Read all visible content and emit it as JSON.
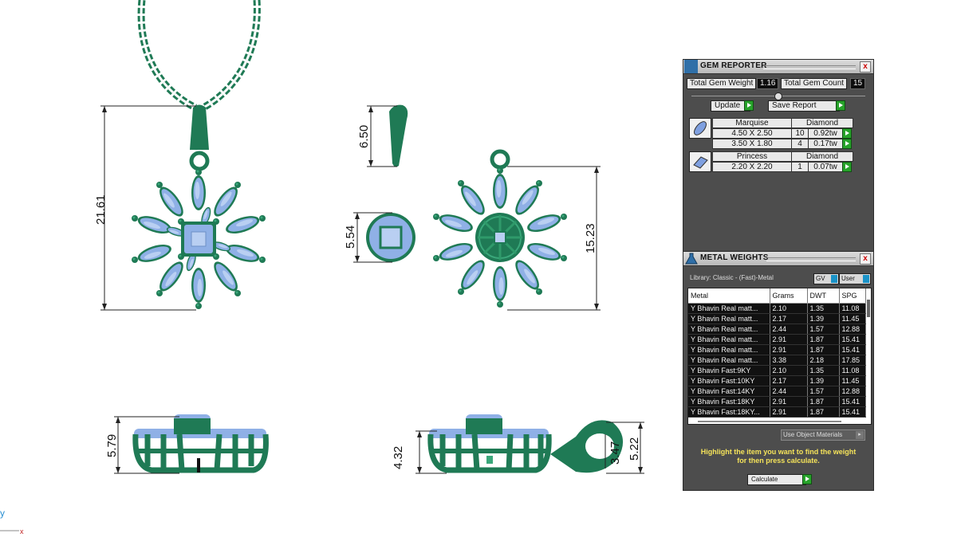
{
  "dimensions": {
    "pendant_height": "21.61",
    "bail_height": "6.50",
    "center_width": "5.54",
    "flower_height": "15.23",
    "side_height_a": "5.79",
    "side_height_b": "4.32",
    "bail_side_a": "3.47",
    "bail_side_b": "5.22"
  },
  "axis": {
    "y_label": "y",
    "x_label": "x"
  },
  "colors": {
    "metal": "#1f7a55",
    "stone": "#8fb0e6",
    "panel_bg": "#4d4d4d",
    "accent_green": "#27a32a",
    "hint_yellow": "#f5e35a"
  },
  "gem_reporter": {
    "title": "GEM REPORTER",
    "close": "x",
    "total_weight_label": "Total Gem Weight",
    "total_weight_value": "1.16",
    "total_count_label": "Total Gem Count",
    "total_count_value": "15",
    "update_label": "Update",
    "save_label": "Save Report",
    "groups": [
      {
        "icon": "marquise-gem-icon",
        "shape": "Marquise",
        "material": "Diamond",
        "rows": [
          {
            "size": "4.50 X 2.50",
            "count": "10",
            "weight": "0.92tw"
          },
          {
            "size": "3.50 X 1.80",
            "count": "4",
            "weight": "0.17tw"
          }
        ]
      },
      {
        "icon": "princess-gem-icon",
        "shape": "Princess",
        "material": "Diamond",
        "rows": [
          {
            "size": "2.20 X 2.20",
            "count": "1",
            "weight": "0.07tw"
          }
        ]
      }
    ]
  },
  "metal_weights": {
    "title": "METAL WEIGHTS",
    "close": "x",
    "library_label": "Library: Classic - (Fast)-Metal",
    "gv_label": "GV",
    "user_label": "User",
    "columns": [
      "Metal",
      "Grams",
      "DWT",
      "SPG"
    ],
    "rows": [
      [
        "Y Bhavin Real matt...",
        "2.10",
        "1.35",
        "11.08"
      ],
      [
        "Y Bhavin Real matt...",
        "2.17",
        "1.39",
        "11.45"
      ],
      [
        "Y Bhavin Real matt...",
        "2.44",
        "1.57",
        "12.88"
      ],
      [
        "Y Bhavin Real matt...",
        "2.91",
        "1.87",
        "15.41"
      ],
      [
        "Y Bhavin Real matt...",
        "2.91",
        "1.87",
        "15.41"
      ],
      [
        "Y Bhavin Real matt...",
        "3.38",
        "2.18",
        "17.85"
      ],
      [
        "Y Bhavin Fast:9KY",
        "2.10",
        "1.35",
        "11.08"
      ],
      [
        "Y Bhavin Fast:10KY",
        "2.17",
        "1.39",
        "11.45"
      ],
      [
        "Y Bhavin Fast:14KY",
        "2.44",
        "1.57",
        "12.88"
      ],
      [
        "Y Bhavin Fast:18KY",
        "2.91",
        "1.87",
        "15.41"
      ],
      [
        "Y Bhavin Fast:18KY...",
        "2.91",
        "1.87",
        "15.41"
      ]
    ],
    "use_object_materials": "Use Object Materials",
    "hint_line1": "Highlight the item you want to find the weight",
    "hint_line2": "for then press calculate.",
    "calculate_label": "Calculate"
  }
}
